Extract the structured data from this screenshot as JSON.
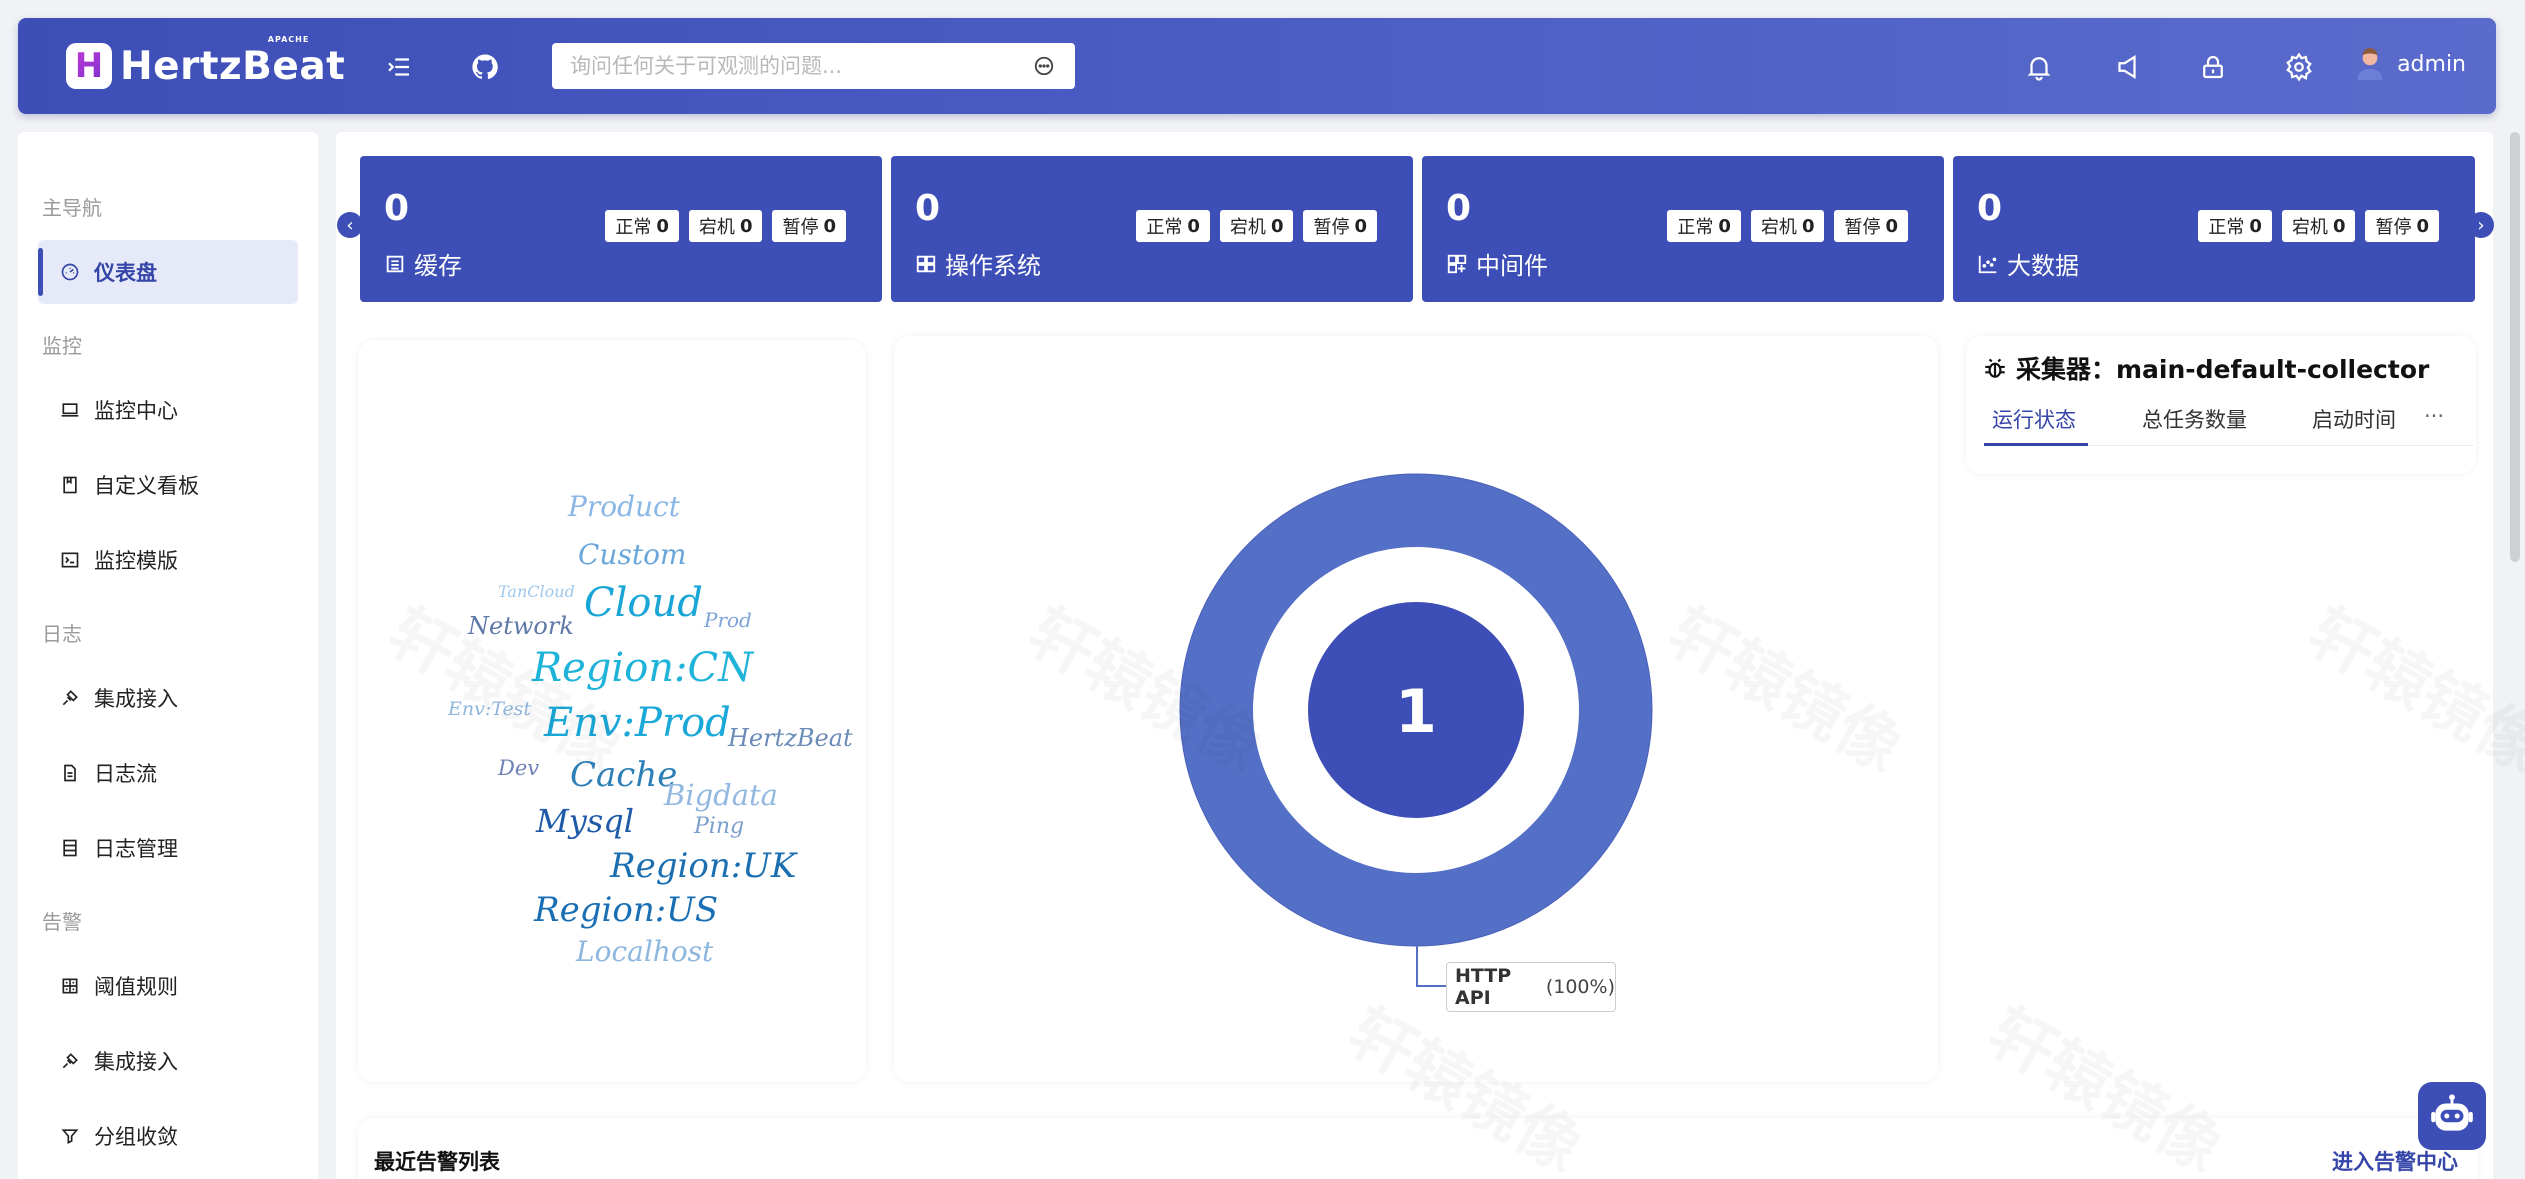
{
  "header": {
    "logo_text": "HertzBeat",
    "logo_sup": "APACHE",
    "logo_mark": "H",
    "search_placeholder": "询问任何关于可观测的问题...",
    "user_name": "admin",
    "icons": [
      "menu-fold-icon",
      "github-icon",
      "bell-icon",
      "sound-icon",
      "lock-icon",
      "gear-icon",
      "user-icon"
    ]
  },
  "sidebar": {
    "groups": [
      {
        "label": "主导航"
      },
      {
        "label": "监控"
      },
      {
        "label": "日志"
      },
      {
        "label": "告警"
      }
    ],
    "items": [
      {
        "label": "仪表盘",
        "icon": "dashboard-icon",
        "active": true
      },
      {
        "label": "监控中心",
        "icon": "laptop-icon"
      },
      {
        "label": "自定义看板",
        "icon": "book-icon"
      },
      {
        "label": "监控模版",
        "icon": "code-icon"
      },
      {
        "label": "集成接入",
        "icon": "api-icon"
      },
      {
        "label": "日志流",
        "icon": "file-icon"
      },
      {
        "label": "日志管理",
        "icon": "table-icon"
      },
      {
        "label": "阈值规则",
        "icon": "calculator-icon"
      },
      {
        "label": "集成接入",
        "icon": "api-icon"
      },
      {
        "label": "分组收敛",
        "icon": "filter-icon"
      }
    ]
  },
  "stats": [
    {
      "count": "0",
      "label": "缓存",
      "icon": "database-icon",
      "normal": "正常",
      "normal_count": "0",
      "down": "宕机",
      "down_count": "0",
      "paused": "暂停",
      "paused_count": "0"
    },
    {
      "count": "0",
      "label": "操作系统",
      "icon": "windows-icon",
      "normal": "正常",
      "normal_count": "0",
      "down": "宕机",
      "down_count": "0",
      "paused": "暂停",
      "paused_count": "0"
    },
    {
      "count": "0",
      "label": "中间件",
      "icon": "appstore-icon",
      "normal": "正常",
      "normal_count": "0",
      "down": "宕机",
      "down_count": "0",
      "paused": "暂停",
      "paused_count": "0"
    },
    {
      "count": "0",
      "label": "大数据",
      "icon": "dot-chart-icon",
      "normal": "正常",
      "normal_count": "0",
      "down": "宕机",
      "down_count": "0",
      "paused": "暂停",
      "paused_count": "0"
    }
  ],
  "word_cloud": [
    {
      "text": "Product",
      "color": "#8ab8e6"
    },
    {
      "text": "Custom",
      "color": "#6aa6da"
    },
    {
      "text": "TanCloud",
      "color": "#9ec7ea"
    },
    {
      "text": "Cloud",
      "color": "#19a6d6"
    },
    {
      "text": "Network",
      "color": "#5f78a8"
    },
    {
      "text": "Prod",
      "color": "#7ea3d8"
    },
    {
      "text": "Region:CN",
      "color": "#1fb3d9"
    },
    {
      "text": "Env:Test",
      "color": "#8fb6dc"
    },
    {
      "text": "Env:Prod",
      "color": "#1aa8d8"
    },
    {
      "text": "HertzBeat",
      "color": "#6b8bb8"
    },
    {
      "text": "Dev",
      "color": "#6f82b8"
    },
    {
      "text": "Cache",
      "color": "#2d7fb8"
    },
    {
      "text": "Bigdata",
      "color": "#92b8e0"
    },
    {
      "text": "Mysql",
      "color": "#1f5aa8"
    },
    {
      "text": "Ping",
      "color": "#7b9fcc"
    },
    {
      "text": "Region:UK",
      "color": "#1b6fb0"
    },
    {
      "text": "Region:US",
      "color": "#1a6fb4"
    },
    {
      "text": "Localhost",
      "color": "#8db7de"
    }
  ],
  "chart_data": {
    "type": "pie",
    "center_value": "1",
    "slices": [
      {
        "name": "HTTP API",
        "value": 1,
        "percent": "100%"
      }
    ],
    "legend_label": "HTTP API",
    "legend_percent": "(100%)",
    "colors": {
      "ring": "#5470c6",
      "center": "#3d4fb6"
    }
  },
  "collector": {
    "title": "采集器：main-default-collector",
    "tabs": [
      "运行状态",
      "总任务数量",
      "启动时间"
    ],
    "more": "···"
  },
  "alerts": {
    "title": "最近告警列表",
    "link": "进入告警中心"
  },
  "nav": {
    "prev": "‹",
    "next": "›"
  },
  "watermark": "轩辕镜像"
}
